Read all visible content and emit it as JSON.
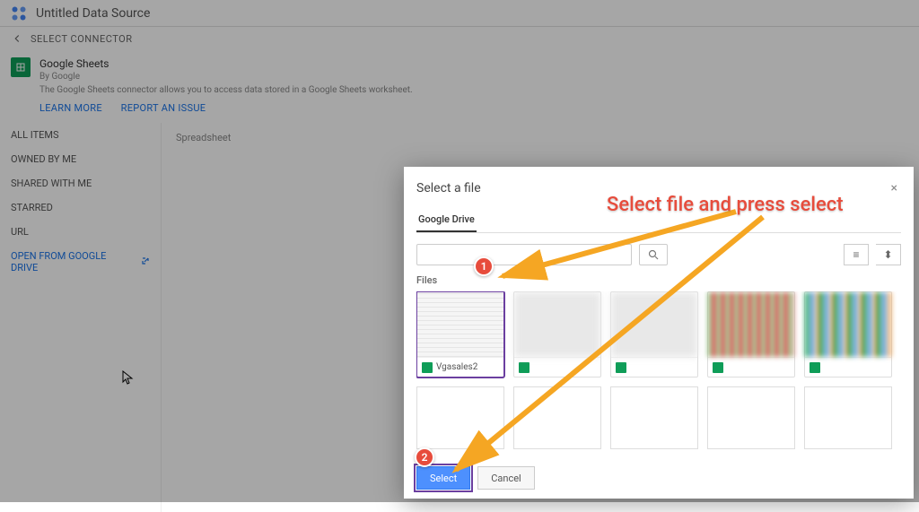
{
  "header": {
    "title": "Untitled Data Source"
  },
  "subheader": {
    "label": "SELECT CONNECTOR"
  },
  "connector": {
    "title": "Google Sheets",
    "by": "By Google",
    "desc": "The Google Sheets connector allows you to access data stored in a Google Sheets worksheet.",
    "learn_more": "LEARN MORE",
    "report_issue": "REPORT AN ISSUE"
  },
  "sidebar": {
    "items": [
      "ALL ITEMS",
      "OWNED BY ME",
      "SHARED WITH ME",
      "STARRED",
      "URL",
      "OPEN FROM GOOGLE DRIVE"
    ]
  },
  "main": {
    "spreadsheet_label": "Spreadsheet"
  },
  "dialog": {
    "title": "Select a file",
    "close": "×",
    "tab": "Google Drive",
    "files_label": "Files",
    "selected_file": "Vgasales2",
    "select_btn": "Select",
    "cancel_btn": "Cancel",
    "view_list": "≡",
    "view_sort": "⬍"
  },
  "annotation": {
    "text": "Select file and press select",
    "badge1": "1",
    "badge2": "2"
  }
}
